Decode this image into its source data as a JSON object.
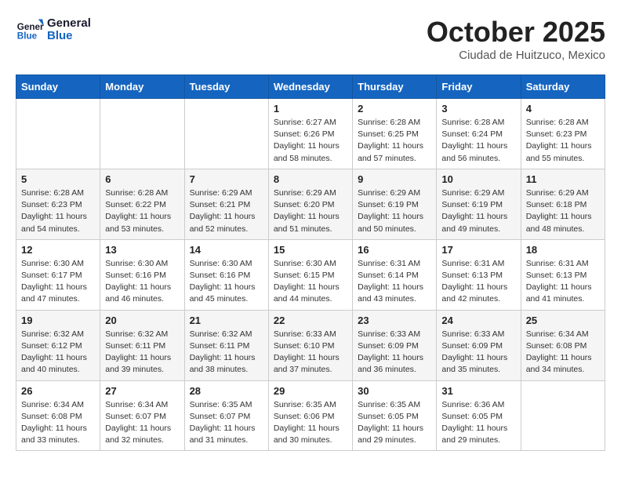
{
  "header": {
    "logo_line1": "General",
    "logo_line2": "Blue",
    "month_title": "October 2025",
    "subtitle": "Ciudad de Huitzuco, Mexico"
  },
  "days_of_week": [
    "Sunday",
    "Monday",
    "Tuesday",
    "Wednesday",
    "Thursday",
    "Friday",
    "Saturday"
  ],
  "weeks": [
    [
      {
        "day": "",
        "info": ""
      },
      {
        "day": "",
        "info": ""
      },
      {
        "day": "",
        "info": ""
      },
      {
        "day": "1",
        "info": "Sunrise: 6:27 AM\nSunset: 6:26 PM\nDaylight: 11 hours and 58 minutes."
      },
      {
        "day": "2",
        "info": "Sunrise: 6:28 AM\nSunset: 6:25 PM\nDaylight: 11 hours and 57 minutes."
      },
      {
        "day": "3",
        "info": "Sunrise: 6:28 AM\nSunset: 6:24 PM\nDaylight: 11 hours and 56 minutes."
      },
      {
        "day": "4",
        "info": "Sunrise: 6:28 AM\nSunset: 6:23 PM\nDaylight: 11 hours and 55 minutes."
      }
    ],
    [
      {
        "day": "5",
        "info": "Sunrise: 6:28 AM\nSunset: 6:23 PM\nDaylight: 11 hours and 54 minutes."
      },
      {
        "day": "6",
        "info": "Sunrise: 6:28 AM\nSunset: 6:22 PM\nDaylight: 11 hours and 53 minutes."
      },
      {
        "day": "7",
        "info": "Sunrise: 6:29 AM\nSunset: 6:21 PM\nDaylight: 11 hours and 52 minutes."
      },
      {
        "day": "8",
        "info": "Sunrise: 6:29 AM\nSunset: 6:20 PM\nDaylight: 11 hours and 51 minutes."
      },
      {
        "day": "9",
        "info": "Sunrise: 6:29 AM\nSunset: 6:19 PM\nDaylight: 11 hours and 50 minutes."
      },
      {
        "day": "10",
        "info": "Sunrise: 6:29 AM\nSunset: 6:19 PM\nDaylight: 11 hours and 49 minutes."
      },
      {
        "day": "11",
        "info": "Sunrise: 6:29 AM\nSunset: 6:18 PM\nDaylight: 11 hours and 48 minutes."
      }
    ],
    [
      {
        "day": "12",
        "info": "Sunrise: 6:30 AM\nSunset: 6:17 PM\nDaylight: 11 hours and 47 minutes."
      },
      {
        "day": "13",
        "info": "Sunrise: 6:30 AM\nSunset: 6:16 PM\nDaylight: 11 hours and 46 minutes."
      },
      {
        "day": "14",
        "info": "Sunrise: 6:30 AM\nSunset: 6:16 PM\nDaylight: 11 hours and 45 minutes."
      },
      {
        "day": "15",
        "info": "Sunrise: 6:30 AM\nSunset: 6:15 PM\nDaylight: 11 hours and 44 minutes."
      },
      {
        "day": "16",
        "info": "Sunrise: 6:31 AM\nSunset: 6:14 PM\nDaylight: 11 hours and 43 minutes."
      },
      {
        "day": "17",
        "info": "Sunrise: 6:31 AM\nSunset: 6:13 PM\nDaylight: 11 hours and 42 minutes."
      },
      {
        "day": "18",
        "info": "Sunrise: 6:31 AM\nSunset: 6:13 PM\nDaylight: 11 hours and 41 minutes."
      }
    ],
    [
      {
        "day": "19",
        "info": "Sunrise: 6:32 AM\nSunset: 6:12 PM\nDaylight: 11 hours and 40 minutes."
      },
      {
        "day": "20",
        "info": "Sunrise: 6:32 AM\nSunset: 6:11 PM\nDaylight: 11 hours and 39 minutes."
      },
      {
        "day": "21",
        "info": "Sunrise: 6:32 AM\nSunset: 6:11 PM\nDaylight: 11 hours and 38 minutes."
      },
      {
        "day": "22",
        "info": "Sunrise: 6:33 AM\nSunset: 6:10 PM\nDaylight: 11 hours and 37 minutes."
      },
      {
        "day": "23",
        "info": "Sunrise: 6:33 AM\nSunset: 6:09 PM\nDaylight: 11 hours and 36 minutes."
      },
      {
        "day": "24",
        "info": "Sunrise: 6:33 AM\nSunset: 6:09 PM\nDaylight: 11 hours and 35 minutes."
      },
      {
        "day": "25",
        "info": "Sunrise: 6:34 AM\nSunset: 6:08 PM\nDaylight: 11 hours and 34 minutes."
      }
    ],
    [
      {
        "day": "26",
        "info": "Sunrise: 6:34 AM\nSunset: 6:08 PM\nDaylight: 11 hours and 33 minutes."
      },
      {
        "day": "27",
        "info": "Sunrise: 6:34 AM\nSunset: 6:07 PM\nDaylight: 11 hours and 32 minutes."
      },
      {
        "day": "28",
        "info": "Sunrise: 6:35 AM\nSunset: 6:07 PM\nDaylight: 11 hours and 31 minutes."
      },
      {
        "day": "29",
        "info": "Sunrise: 6:35 AM\nSunset: 6:06 PM\nDaylight: 11 hours and 30 minutes."
      },
      {
        "day": "30",
        "info": "Sunrise: 6:35 AM\nSunset: 6:05 PM\nDaylight: 11 hours and 29 minutes."
      },
      {
        "day": "31",
        "info": "Sunrise: 6:36 AM\nSunset: 6:05 PM\nDaylight: 11 hours and 29 minutes."
      },
      {
        "day": "",
        "info": ""
      }
    ]
  ]
}
